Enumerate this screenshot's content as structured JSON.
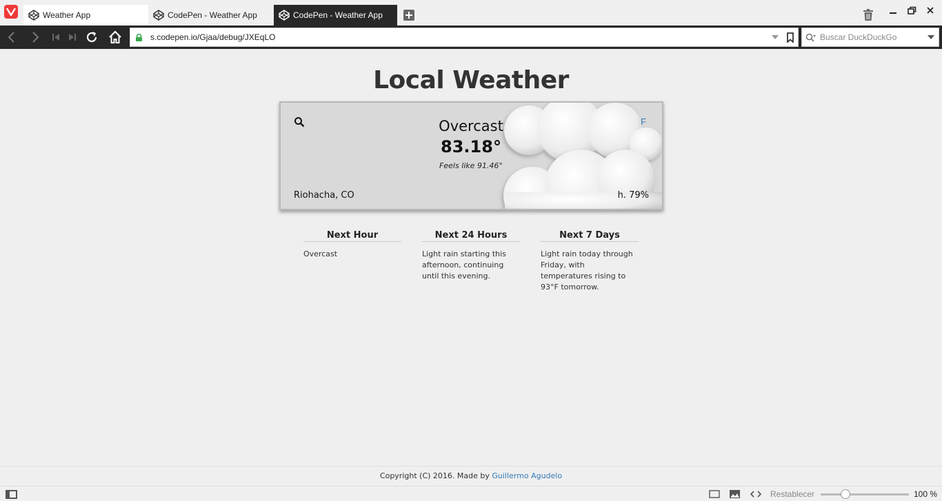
{
  "browser": {
    "tabs": [
      {
        "label": "Weather App",
        "active": false
      },
      {
        "label": "CodePen - Weather App",
        "active": false
      },
      {
        "label": "CodePen - Weather App",
        "active": true
      }
    ],
    "url": "s.codepen.io/Gjaa/debug/JXEqLO",
    "search_placeholder": "Buscar DuckDuckGo",
    "zoom_reset_label": "Restablecer",
    "zoom_level": "100 %",
    "zoom_value": 100
  },
  "page": {
    "title": "Local Weather",
    "current": {
      "condition": "Overcast",
      "temperature": "83.18°",
      "feels_like": "Feels like 91.46°",
      "unit_toggle": "F",
      "location": "Riohacha, CO",
      "humidity": "h. 79%"
    },
    "forecast": [
      {
        "heading": "Next Hour",
        "summary": "Overcast"
      },
      {
        "heading": "Next 24 Hours",
        "summary": "Light rain starting this afternoon, continuing until this evening."
      },
      {
        "heading": "Next 7 Days",
        "summary": "Light rain today through Friday, with temperatures rising to 93°F tomorrow."
      }
    ],
    "footer": {
      "text": "Copyright (C) 2016. Made by",
      "author": "Guillermo Agudelo"
    }
  },
  "colors": {
    "link": "#337ab7",
    "chrome_dark": "#282828",
    "vivaldi_red": "#ef3939"
  }
}
